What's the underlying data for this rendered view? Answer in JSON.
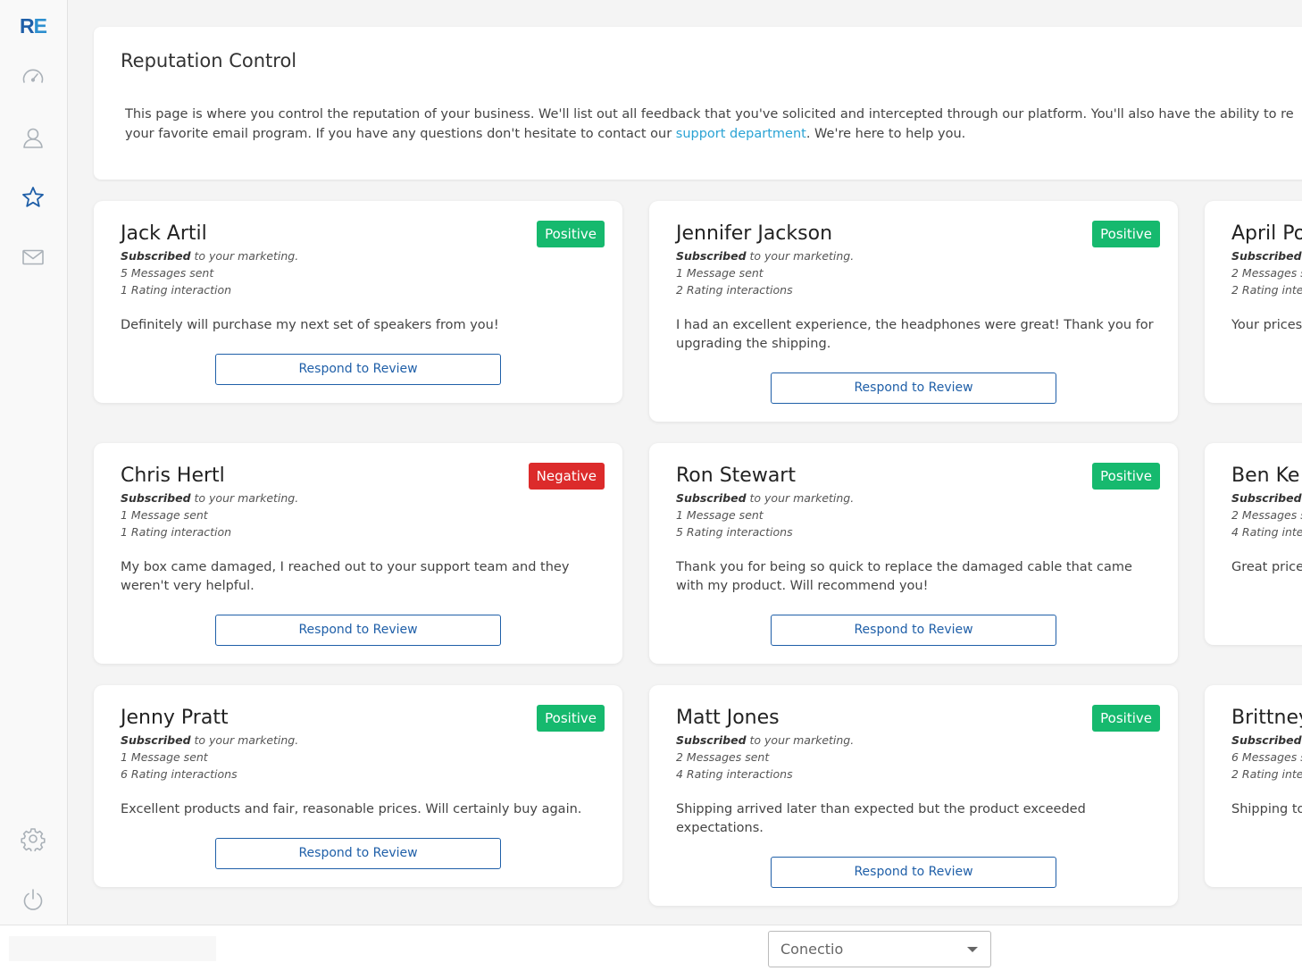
{
  "app": {
    "logo_r": "R",
    "logo_e": "E"
  },
  "sidebar": {
    "items": [
      {
        "icon": "dashboard-gauge-icon"
      },
      {
        "icon": "contacts-icon"
      },
      {
        "icon": "star-icon",
        "active": true
      },
      {
        "icon": "mail-icon"
      },
      {
        "icon": "settings-gear-icon"
      },
      {
        "icon": "power-icon"
      }
    ],
    "colors": {
      "inactive": "#aab1b8",
      "active": "#1f5fa8"
    }
  },
  "header": {
    "title": "Reputation Control",
    "intro_line1": "This page is where you control the reputation of your business. We'll list out all feedback that you've solicited and intercepted through our platform. You'll also have the ability to re",
    "intro_line2_before": "your favorite email program. If you have any questions don't hesitate to contact our ",
    "intro_link": "support department",
    "intro_line2_after": ". We're here to help you."
  },
  "reviews": [
    {
      "name": "Jack Artil",
      "sentiment": "Positive",
      "subscribed": "Subscribed",
      "subscribed_rest": " to your marketing.",
      "messages_count": "5",
      "messages_label": " Messages sent",
      "ratings_count": "1",
      "ratings_label": " Rating interaction",
      "text": "Definitely will purchase my next set of speakers from you!",
      "button": "Respond to Review"
    },
    {
      "name": "Jennifer Jackson",
      "sentiment": "Positive",
      "subscribed": "Subscribed",
      "subscribed_rest": " to your marketing.",
      "messages_count": "1",
      "messages_label": " Message sent",
      "ratings_count": "2",
      "ratings_label": " Rating interactions",
      "text": "I had an excellent experience, the headphones were great! Thank you for upgrading the shipping.",
      "button": "Respond to Review"
    },
    {
      "name": "April Po",
      "sentiment": "",
      "subscribed": "Subscribed i",
      "subscribed_rest": "",
      "messages_count": "2",
      "messages_label": " Messages s",
      "ratings_count": "2",
      "ratings_label": " Rating inte",
      "text": "Your prices",
      "button": ""
    },
    {
      "name": "Chris Hertl",
      "sentiment": "Negative",
      "subscribed": "Subscribed",
      "subscribed_rest": " to your marketing.",
      "messages_count": "1",
      "messages_label": " Message sent",
      "ratings_count": "1",
      "ratings_label": " Rating interaction",
      "text": "My box came damaged, I reached out to your support team and they weren't very helpful.",
      "button": "Respond to Review"
    },
    {
      "name": "Ron Stewart",
      "sentiment": "Positive",
      "subscribed": "Subscribed",
      "subscribed_rest": " to your marketing.",
      "messages_count": "1",
      "messages_label": " Message sent",
      "ratings_count": "5",
      "ratings_label": " Rating interactions",
      "text": "Thank you for being so quick to replace the damaged cable that came with my product. Will recommend you!",
      "button": "Respond to Review"
    },
    {
      "name": "Ben Ke",
      "sentiment": "",
      "subscribed": "Subscribed i",
      "subscribed_rest": "",
      "messages_count": "2",
      "messages_label": " Messages s",
      "ratings_count": "4",
      "ratings_label": " Rating inte",
      "text": "Great prices",
      "button": ""
    },
    {
      "name": "Jenny Pratt",
      "sentiment": "Positive",
      "subscribed": "Subscribed",
      "subscribed_rest": " to your marketing.",
      "messages_count": "1",
      "messages_label": " Message sent",
      "ratings_count": "6",
      "ratings_label": " Rating interactions",
      "text": "Excellent products and fair, reasonable prices. Will certainly buy again.",
      "button": "Respond to Review"
    },
    {
      "name": "Matt Jones",
      "sentiment": "Positive",
      "subscribed": "Subscribed",
      "subscribed_rest": " to your marketing.",
      "messages_count": "2",
      "messages_label": " Messages sent",
      "ratings_count": "4",
      "ratings_label": " Rating interactions",
      "text": "Shipping arrived later than expected but the product exceeded expectations.",
      "button": "Respond to Review"
    },
    {
      "name": "Brittney",
      "sentiment": "",
      "subscribed": "Subscribed i",
      "subscribed_rest": "",
      "messages_count": "6",
      "messages_label": " Messages s",
      "ratings_count": "2",
      "ratings_label": " Rating inte",
      "text": "Shipping to",
      "button": ""
    }
  ],
  "footer": {
    "select_value": "Conectio"
  },
  "colors": {
    "positive": "#16b96e",
    "negative": "#dc2b2b",
    "brand": "#1f5fa8",
    "link": "#2aa3d4"
  }
}
